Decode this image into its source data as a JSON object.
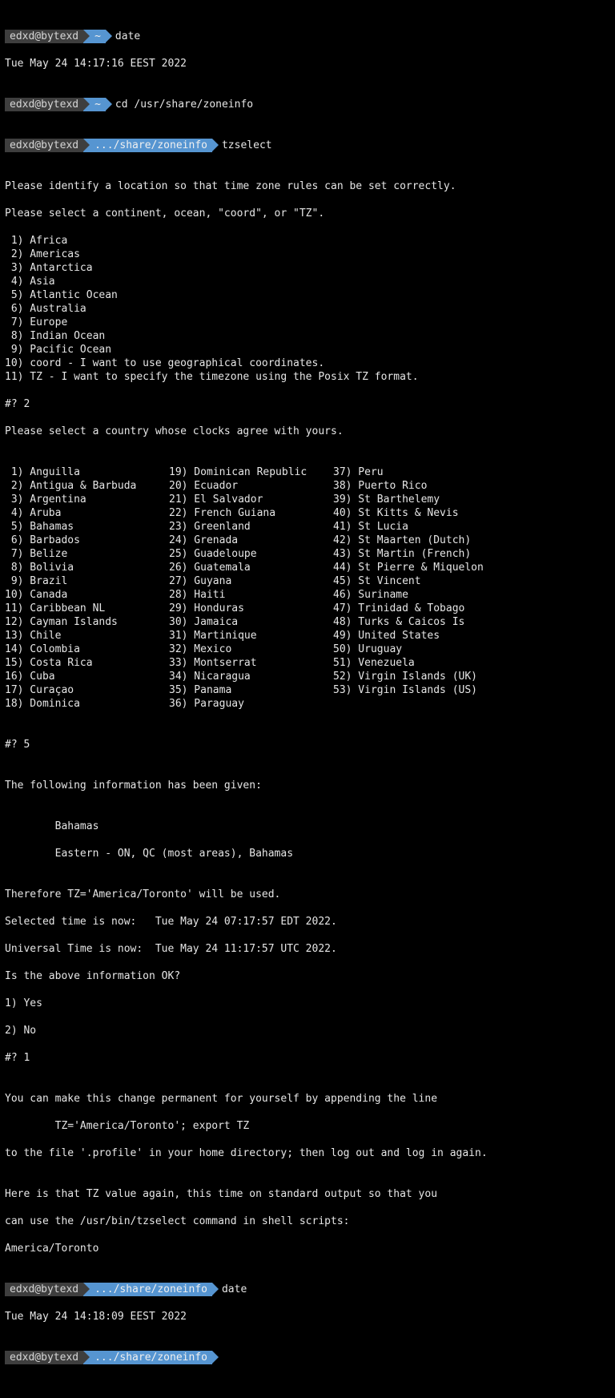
{
  "prompt": {
    "user": "edxd@bytexd",
    "home": "~",
    "path": ".../share/zoneinfo"
  },
  "cmds": {
    "date": "date",
    "cd": "cd /usr/share/zoneinfo",
    "tzselect": "tzselect"
  },
  "date_out1": "Tue May 24 14:17:16 EEST 2022",
  "tz": {
    "prompt1": "Please identify a location so that time zone rules can be set correctly.",
    "prompt2": "Please select a continent, ocean, \"coord\", or \"TZ\".",
    "continents": [
      " 1) Africa",
      " 2) Americas",
      " 3) Antarctica",
      " 4) Asia",
      " 5) Atlantic Ocean",
      " 6) Australia",
      " 7) Europe",
      " 8) Indian Ocean",
      " 9) Pacific Ocean",
      "10) coord - I want to use geographical coordinates.",
      "11) TZ - I want to specify the timezone using the Posix TZ format."
    ],
    "ans1": "#? 2",
    "country_prompt": "Please select a country whose clocks agree with yours.",
    "countries_col1": [
      " 1) Anguilla",
      " 2) Antigua & Barbuda",
      " 3) Argentina",
      " 4) Aruba",
      " 5) Bahamas",
      " 6) Barbados",
      " 7) Belize",
      " 8) Bolivia",
      " 9) Brazil",
      "10) Canada",
      "11) Caribbean NL",
      "12) Cayman Islands",
      "13) Chile",
      "14) Colombia",
      "15) Costa Rica",
      "16) Cuba",
      "17) Curaçao",
      "18) Dominica"
    ],
    "countries_col2": [
      "19) Dominican Republic",
      "20) Ecuador",
      "21) El Salvador",
      "22) French Guiana",
      "23) Greenland",
      "24) Grenada",
      "25) Guadeloupe",
      "26) Guatemala",
      "27) Guyana",
      "28) Haiti",
      "29) Honduras",
      "30) Jamaica",
      "31) Martinique",
      "32) Mexico",
      "33) Montserrat",
      "34) Nicaragua",
      "35) Panama",
      "36) Paraguay"
    ],
    "countries_col3": [
      "37) Peru",
      "38) Puerto Rico",
      "39) St Barthelemy",
      "40) St Kitts & Nevis",
      "41) St Lucia",
      "42) St Maarten (Dutch)",
      "43) St Martin (French)",
      "44) St Pierre & Miquelon",
      "45) St Vincent",
      "46) Suriname",
      "47) Trinidad & Tobago",
      "48) Turks & Caicos Is",
      "49) United States",
      "50) Uruguay",
      "51) Venezuela",
      "52) Virgin Islands (UK)",
      "53) Virgin Islands (US)"
    ],
    "ans2": "#? 5",
    "blank": "",
    "info_given": "The following information has been given:",
    "info_indent1": "        Bahamas",
    "info_indent2": "        Eastern - ON, QC (most areas), Bahamas",
    "therefore": "Therefore TZ='America/Toronto' will be used.",
    "selected_time": "Selected time is now:   Tue May 24 07:17:57 EDT 2022.",
    "universal_time": "Universal Time is now:  Tue May 24 11:17:57 UTC 2022.",
    "ok_prompt": "Is the above information OK?",
    "ok_opt1": "1) Yes",
    "ok_opt2": "2) No",
    "ans3": "#? 1",
    "perm1": "You can make this change permanent for yourself by appending the line",
    "perm2": "        TZ='America/Toronto'; export TZ",
    "perm3": "to the file '.profile' in your home directory; then log out and log in again.",
    "here1": "Here is that TZ value again, this time on standard output so that you",
    "here2": "can use the /usr/bin/tzselect command in shell scripts:",
    "tzvalue": "America/Toronto"
  },
  "date_out2": "Tue May 24 14:18:09 EEST 2022"
}
